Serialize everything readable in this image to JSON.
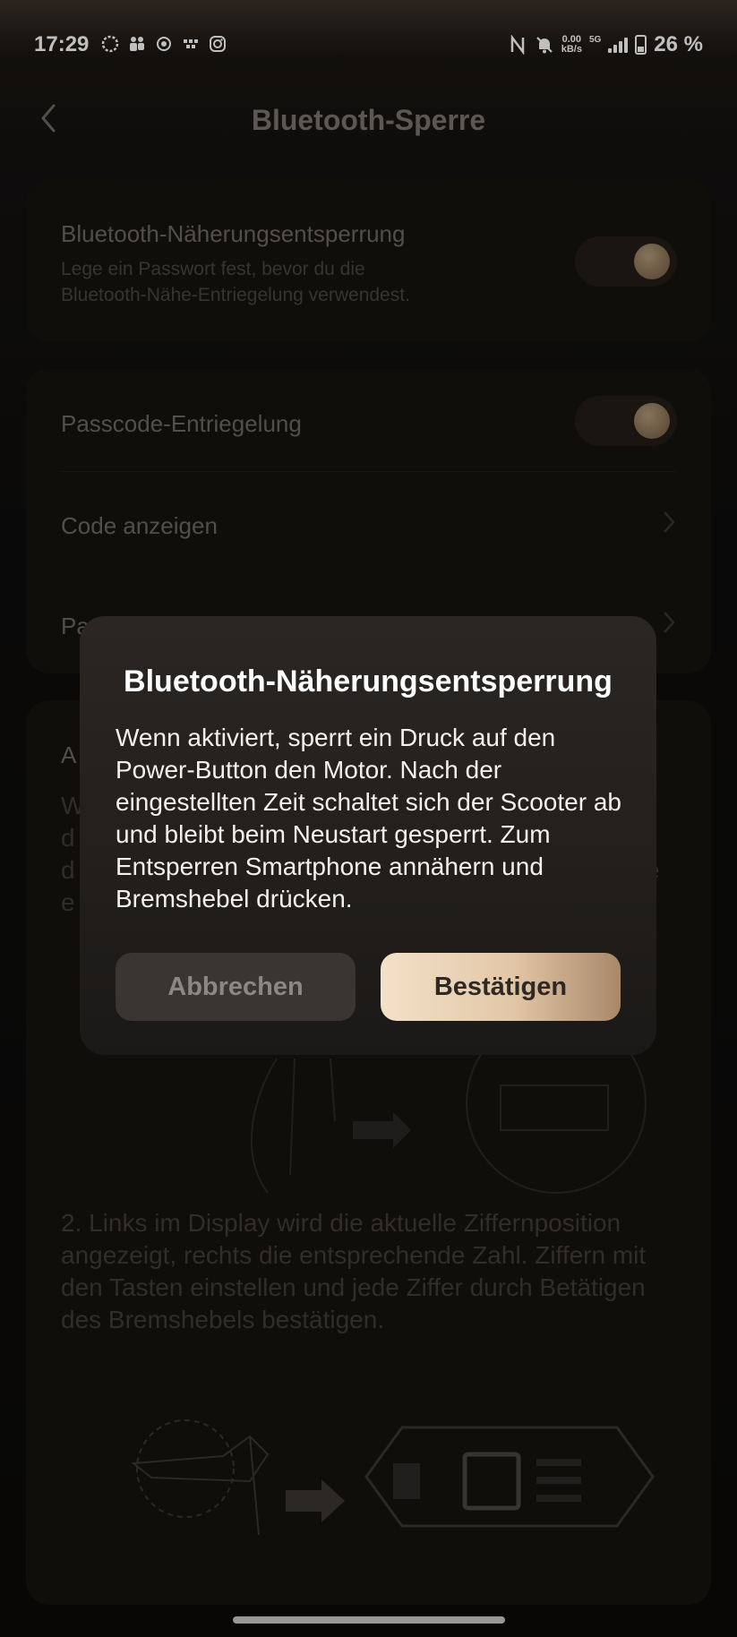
{
  "status_bar": {
    "time": "17:29",
    "net_speed_value": "0.00",
    "net_speed_unit": "kB/s",
    "network": "5G",
    "battery": "26 %"
  },
  "header": {
    "title": "Bluetooth-Sperre"
  },
  "settings": {
    "proximity": {
      "title": "Bluetooth-Näherungsentsperrung",
      "subtitle_line1": "Lege ein Passwort fest, bevor du die",
      "subtitle_line2": "Bluetooth-Nähe-Entriegelung verwendest.",
      "enabled": true
    },
    "passcode": {
      "title": "Passcode-Entriegelung",
      "enabled": true
    },
    "show_code": "Code anzeigen",
    "change_code_partial": "Pa"
  },
  "instructions": {
    "section_title_partial": "A",
    "step1_partial_lines": [
      "W",
      "d",
      "d",
      "e"
    ],
    "step1_partial_right": "e",
    "step2": "2. Links im Display wird die aktuelle Ziffernposition angezeigt, rechts die entsprechende Zahl. Ziffern mit den Tasten einstellen und jede Ziffer durch Betätigen des Bremshebels bestätigen."
  },
  "dialog": {
    "title": "Bluetooth-Näherungsentsperrung",
    "body": "Wenn aktiviert, sperrt ein Druck auf den Power-Button den Motor. Nach der eingestellten Zeit schaltet sich der Scooter ab und bleibt beim Neustart gesperrt. Zum Entsperren Smartphone annähern und Bremshebel drücken.",
    "cancel_label": "Abbrechen",
    "confirm_label": "Bestätigen"
  },
  "colors": {
    "accent_gold": "#e2c7a7",
    "toggle_knob": "#b39a78",
    "background": "#0b0a09"
  },
  "icons": [
    "back-arrow-icon",
    "chevron-right-icon",
    "bell-off-icon",
    "nfc-icon",
    "signal-icon",
    "battery-icon"
  ]
}
